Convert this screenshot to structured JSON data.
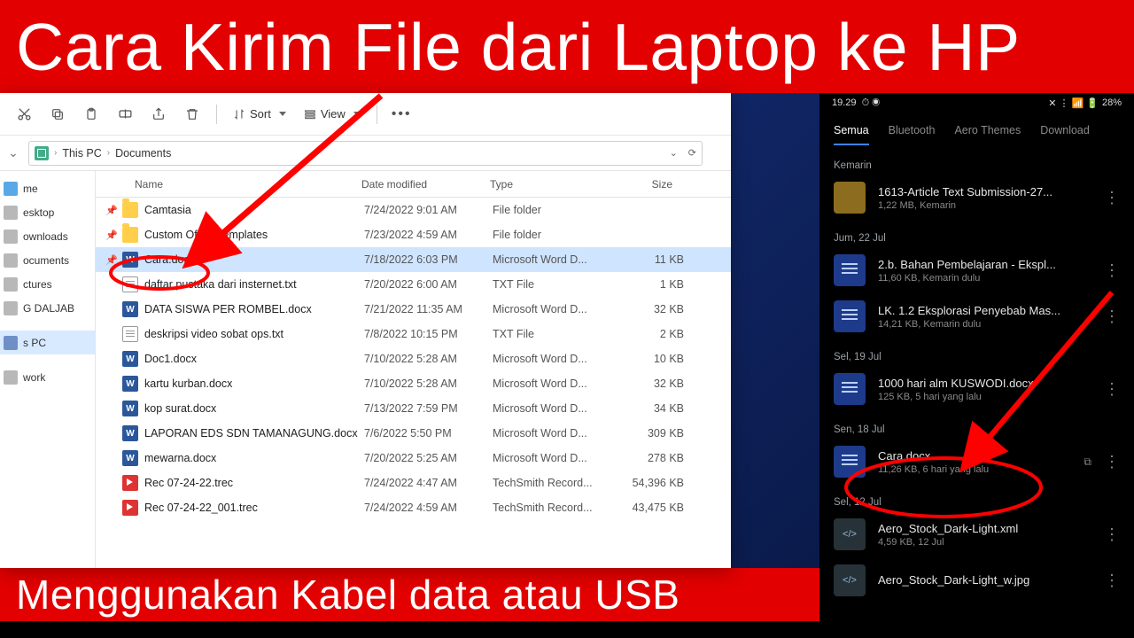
{
  "banners": {
    "top": "Cara Kirim File dari Laptop ke HP",
    "bottom": "Menggunakan Kabel data atau USB"
  },
  "toolbar": {
    "sort": "Sort",
    "view": "View"
  },
  "breadcrumb": {
    "root": "This PC",
    "folder": "Documents"
  },
  "navpane": {
    "items": [
      {
        "label": "me",
        "type": "home"
      },
      {
        "label": "esktop",
        "type": "gen"
      },
      {
        "label": "ownloads",
        "type": "gen"
      },
      {
        "label": "ocuments",
        "type": "gen"
      },
      {
        "label": "ctures",
        "type": "gen"
      },
      {
        "label": "G DALJAB",
        "type": "gen"
      },
      {
        "label": "s PC",
        "type": "pc",
        "sel": true
      },
      {
        "label": "work",
        "type": "gen"
      }
    ]
  },
  "columns": {
    "name": "Name",
    "date": "Date modified",
    "type": "Type",
    "size": "Size"
  },
  "files": [
    {
      "pin": "📌",
      "icon": "folder",
      "name": "Camtasia",
      "date": "7/24/2022 9:01 AM",
      "type": "File folder",
      "size": ""
    },
    {
      "pin": "📌",
      "icon": "folder",
      "name": "Custom Office Templates",
      "date": "7/23/2022 4:59 AM",
      "type": "File folder",
      "size": ""
    },
    {
      "pin": "📌",
      "icon": "word",
      "name": "Cara.docx",
      "date": "7/18/2022 6:03 PM",
      "type": "Microsoft Word D...",
      "size": "11 KB",
      "sel": true
    },
    {
      "pin": "",
      "icon": "txt",
      "name": "daftar pustaka dari insternet.txt",
      "date": "7/20/2022 6:00 AM",
      "type": "TXT File",
      "size": "1 KB"
    },
    {
      "pin": "",
      "icon": "word",
      "name": "DATA SISWA PER ROMBEL.docx",
      "date": "7/21/2022 11:35 AM",
      "type": "Microsoft Word D...",
      "size": "32 KB"
    },
    {
      "pin": "",
      "icon": "txt",
      "name": "deskripsi video sobat ops.txt",
      "date": "7/8/2022 10:15 PM",
      "type": "TXT File",
      "size": "2 KB"
    },
    {
      "pin": "",
      "icon": "word",
      "name": "Doc1.docx",
      "date": "7/10/2022 5:28 AM",
      "type": "Microsoft Word D...",
      "size": "10 KB"
    },
    {
      "pin": "",
      "icon": "word",
      "name": "kartu kurban.docx",
      "date": "7/10/2022 5:28 AM",
      "type": "Microsoft Word D...",
      "size": "32 KB"
    },
    {
      "pin": "",
      "icon": "word",
      "name": "kop surat.docx",
      "date": "7/13/2022 7:59 PM",
      "type": "Microsoft Word D...",
      "size": "34 KB"
    },
    {
      "pin": "",
      "icon": "word",
      "name": "LAPORAN EDS SDN TAMANAGUNG.docx",
      "date": "7/6/2022 5:50 PM",
      "type": "Microsoft Word D...",
      "size": "309 KB"
    },
    {
      "pin": "",
      "icon": "word",
      "name": "mewarna.docx",
      "date": "7/20/2022 5:25 AM",
      "type": "Microsoft Word D...",
      "size": "278 KB"
    },
    {
      "pin": "",
      "icon": "trec",
      "name": "Rec 07-24-22.trec",
      "date": "7/24/2022 4:47 AM",
      "type": "TechSmith Record...",
      "size": "54,396 KB"
    },
    {
      "pin": "",
      "icon": "trec",
      "name": "Rec 07-24-22_001.trec",
      "date": "7/24/2022 4:59 AM",
      "type": "TechSmith Record...",
      "size": "43,475 KB"
    }
  ],
  "phone": {
    "time": "19.29",
    "battery": "28%",
    "tabs": [
      "Semua",
      "Bluetooth",
      "Aero Themes",
      "Download"
    ],
    "sections": [
      {
        "head": "Kemarin",
        "items": [
          {
            "icon": "pdf",
            "name": "1613-Article Text Submission-27...",
            "meta": "1,22 MB, Kemarin"
          }
        ]
      },
      {
        "head": "Jum, 22 Jul",
        "items": [
          {
            "icon": "docx",
            "name": "2.b. Bahan Pembelajaran - Ekspl...",
            "meta": "11,60 KB, Kemarin dulu"
          },
          {
            "icon": "docxl",
            "name": "LK. 1.2 Eksplorasi Penyebab Mas...",
            "meta": "14,21 KB, Kemarin dulu"
          }
        ]
      },
      {
        "head": "Sel, 19 Jul",
        "items": [
          {
            "icon": "docxl",
            "name": "1000 hari alm KUSWODI.docx",
            "meta": "125 KB, 5 hari yang lalu"
          }
        ]
      },
      {
        "head": "Sen, 18 Jul",
        "items": [
          {
            "icon": "docxl",
            "name": "Cara.docx",
            "meta": "11,26 KB, 6 hari yang lalu",
            "copy": true
          }
        ]
      },
      {
        "head": "Sel, 12 Jul",
        "items": [
          {
            "icon": "xml",
            "name": "Aero_Stock_Dark-Light.xml",
            "meta": "4,59 KB, 12 Jul"
          },
          {
            "icon": "xml",
            "name": "Aero_Stock_Dark-Light_w.jpg",
            "meta": ""
          }
        ]
      }
    ]
  }
}
